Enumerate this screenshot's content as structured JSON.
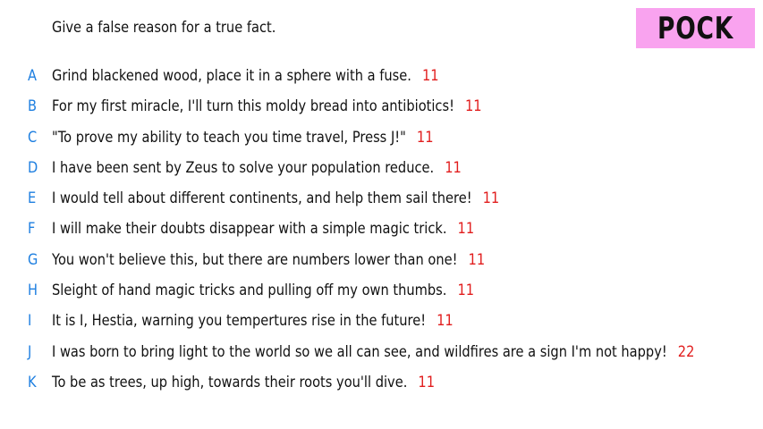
{
  "prompt": "Give a false reason for a true fact.",
  "badge": {
    "text": "POCK",
    "color": "#f9a3ef"
  },
  "colors": {
    "letter": "#1e7fe0",
    "score": "#e11d1d",
    "text": "#111111"
  },
  "answers": [
    {
      "letter": "A",
      "text": "Grind blackened wood, place it in a sphere with a fuse.",
      "score": "11"
    },
    {
      "letter": "B",
      "text": "For my first miracle, I'll turn this moldy bread into antibiotics!",
      "score": "11"
    },
    {
      "letter": "C",
      "text": "\"To prove my ability to teach you time travel, Press J!\"",
      "score": "11"
    },
    {
      "letter": "D",
      "text": "I have been sent by Zeus to solve your population reduce.",
      "score": "11"
    },
    {
      "letter": "E",
      "text": "I would tell about different continents, and help them sail there!",
      "score": "11"
    },
    {
      "letter": "F",
      "text": "I will make their doubts disappear with a simple magic trick.",
      "score": "11"
    },
    {
      "letter": "G",
      "text": "You won't believe this, but there are numbers lower than one!",
      "score": "11"
    },
    {
      "letter": "H",
      "text": "Sleight of hand magic tricks and pulling off my own thumbs.",
      "score": "11"
    },
    {
      "letter": "I",
      "text": "It is I, Hestia, warning you tempertures rise in the future!",
      "score": "11"
    },
    {
      "letter": "J",
      "text": "I was born to bring light to the world so we all can see, and wildfires are a sign I'm not happy!",
      "score": "22"
    },
    {
      "letter": "K",
      "text": "To be as trees, up high, towards their roots you'll dive.",
      "score": "11"
    }
  ]
}
